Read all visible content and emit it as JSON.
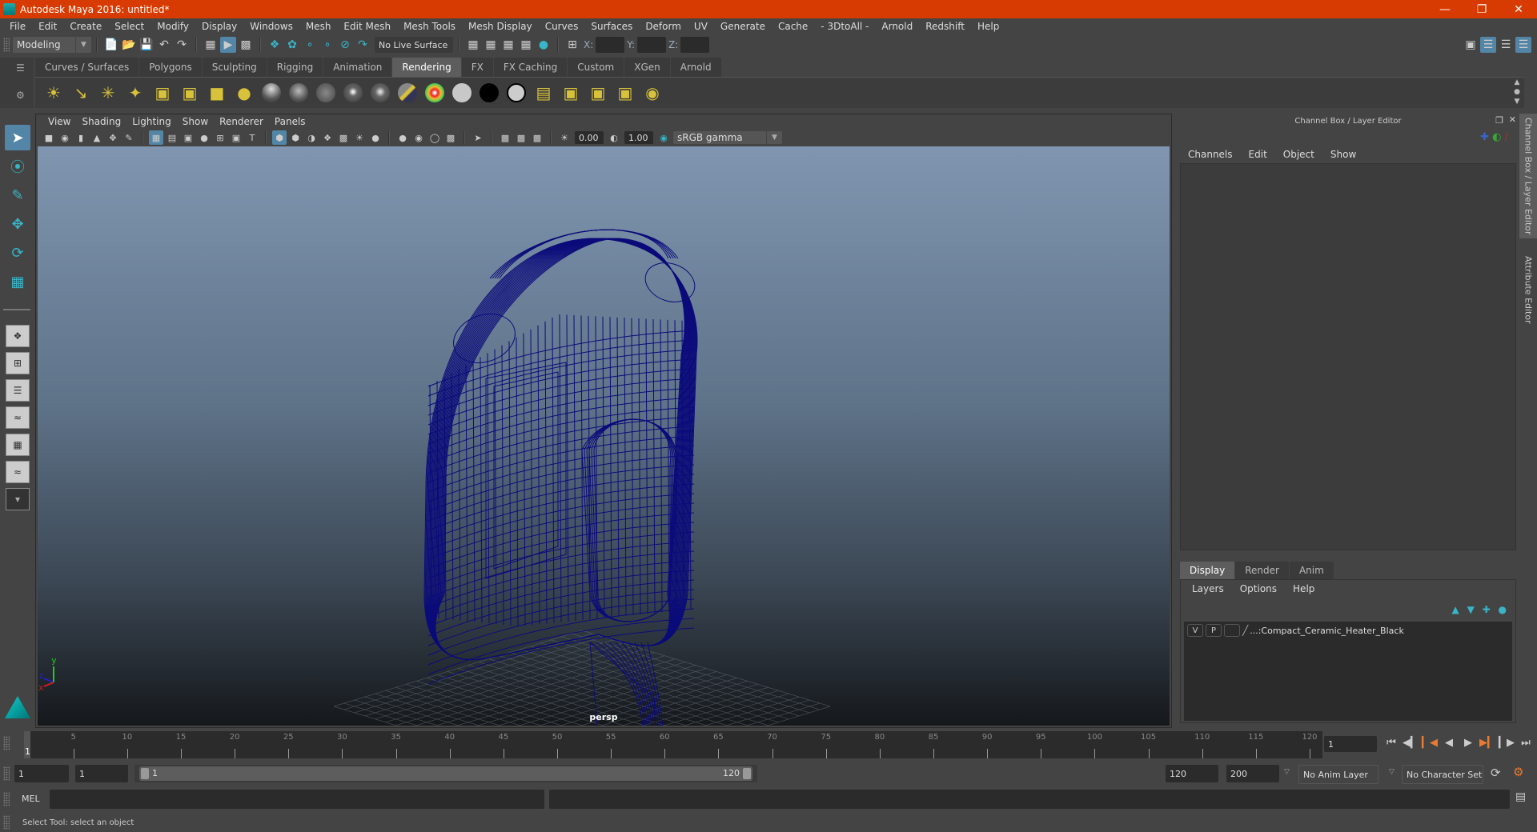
{
  "window": {
    "title": "Autodesk Maya 2016: untitled*",
    "controls": [
      "minimize",
      "restore",
      "close"
    ]
  },
  "menubar": [
    "File",
    "Edit",
    "Create",
    "Select",
    "Modify",
    "Display",
    "Windows",
    "Mesh",
    "Edit Mesh",
    "Mesh Tools",
    "Mesh Display",
    "Curves",
    "Surfaces",
    "Deform",
    "UV",
    "Generate",
    "Cache",
    "- 3DtoAll -",
    "Arnold",
    "Redshift",
    "Help"
  ],
  "statusline": {
    "mode": "Modeling",
    "live_surface": "No Live Surface",
    "x_label": "X:",
    "y_label": "Y:",
    "z_label": "Z:",
    "x_value": "",
    "y_value": "",
    "z_value": ""
  },
  "shelf": {
    "tabs": [
      "Curves / Surfaces",
      "Polygons",
      "Sculpting",
      "Rigging",
      "Animation",
      "Rendering",
      "FX",
      "FX Caching",
      "Custom",
      "XGen",
      "Arnold"
    ],
    "active_tab": "Rendering"
  },
  "viewport": {
    "menu": [
      "View",
      "Shading",
      "Lighting",
      "Show",
      "Renderer",
      "Panels"
    ],
    "exposure": "0.00",
    "gamma": "1.00",
    "color_space": "sRGB gamma",
    "camera": "persp",
    "axis": {
      "x": "x",
      "y": "y",
      "z": "z"
    },
    "wire_color": "#0b0b7a"
  },
  "channel_box": {
    "title": "Channel Box / Layer Editor",
    "menu": [
      "Channels",
      "Edit",
      "Object",
      "Show"
    ]
  },
  "layer_editor": {
    "tabs": [
      "Display",
      "Render",
      "Anim"
    ],
    "active_tab": "Display",
    "menu": [
      "Layers",
      "Options",
      "Help"
    ],
    "layers": [
      {
        "v": "V",
        "p": "P",
        "name": "...:Compact_Ceramic_Heater_Black"
      }
    ]
  },
  "side_tabs": [
    "Channel Box / Layer Editor",
    "Attribute Editor"
  ],
  "timeline": {
    "ticks": [
      5,
      10,
      15,
      20,
      25,
      30,
      35,
      40,
      45,
      50,
      55,
      60,
      65,
      70,
      75,
      80,
      85,
      90,
      95,
      100,
      105,
      110,
      115,
      120
    ],
    "start": 1,
    "end": 120,
    "current_frame": "1",
    "current_marker": "1"
  },
  "range": {
    "start_time": "1",
    "playback_start": "1",
    "slider_start": "1",
    "slider_end": "120",
    "playback_end": "120",
    "end_time": "200",
    "anim_layer": "No Anim Layer",
    "character_set": "No Character Set"
  },
  "command": {
    "label": "MEL",
    "input": "",
    "output": ""
  },
  "help_line": "Select Tool: select an object"
}
